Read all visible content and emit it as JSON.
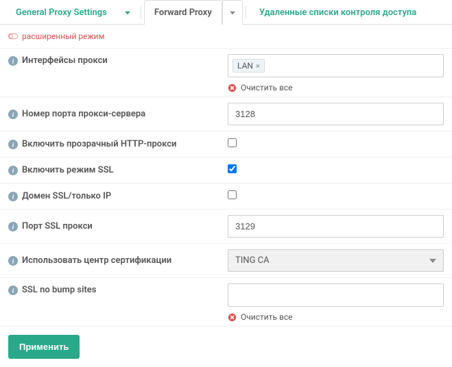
{
  "tabs": {
    "general": "General Proxy Settings",
    "forward": "Forward Proxy",
    "remote": "Удаленные списки контроля доступа"
  },
  "mode": "расширенный режим",
  "labels": {
    "interfaces": "Интерфейсы прокси",
    "port": "Номер порта прокси-сервера",
    "transparent_http": "Включить прозрачный HTTP-прокси",
    "enable_ssl": "Включить режим SSL",
    "ssl_domain_ip": "Домен SSL/только IP",
    "ssl_port": "Порт SSL прокси",
    "ca": "Использовать центр сертификации",
    "nobump": "SSL no bump sites"
  },
  "values": {
    "interfaces_tokens": [
      "LAN"
    ],
    "port": "3128",
    "transparent_http": false,
    "enable_ssl": true,
    "ssl_domain_ip": false,
    "ssl_port": "3129",
    "ca": "TING CA",
    "nobump": ""
  },
  "actions": {
    "clear_all": "Очистить все",
    "apply": "Применить"
  }
}
